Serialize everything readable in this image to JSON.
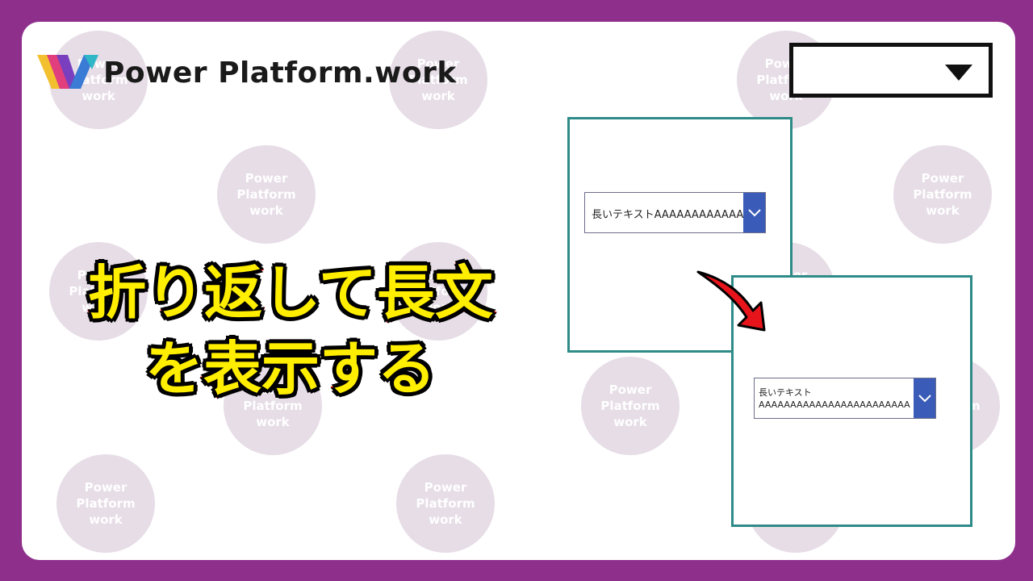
{
  "brand": {
    "name": "Power Platform.work",
    "logo_icon": "power-platform-logo"
  },
  "watermark": {
    "text": "Power\nPlatform\nwork",
    "color": "#e6dde6"
  },
  "headline": {
    "line1": "折り返して長文",
    "line2": "を表示する",
    "fill": "#ffee00",
    "stroke": "#d80000"
  },
  "corner_dropdown": {
    "value": "",
    "icon": "caret-down-icon"
  },
  "before_panel": {
    "combo_text": "長いテキストAAAAAAAAAAAAAAAAAAAAAAAA",
    "icon": "chevron-down-icon"
  },
  "after_panel": {
    "combo_text": "長いテキスト\nAAAAAAAAAAAAAAAAAAAAAAAA",
    "icon": "chevron-down-icon"
  },
  "colors": {
    "frame": "#8e2f8c",
    "panel_border": "#2e8b87",
    "button": "#3a5cb8",
    "arrow": "#e8141b"
  }
}
